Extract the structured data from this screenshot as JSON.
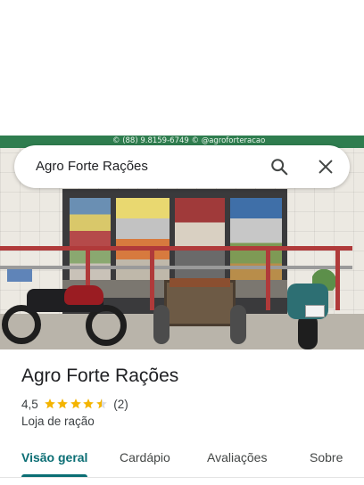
{
  "photo": {
    "banner_text": "© (88) 9.8159-6749 © @agroforteracao"
  },
  "search": {
    "query": "Agro Forte Rações",
    "search_icon": "search-icon",
    "close_icon": "close-icon"
  },
  "place": {
    "name": "Agro Forte Rações",
    "rating": "4,5",
    "stars": 4.5,
    "review_count": "(2)",
    "category": "Loja de ração",
    "star_color": "#f4b400"
  },
  "tabs": [
    {
      "label": "Visão geral",
      "active": true
    },
    {
      "label": "Cardápio",
      "active": false
    },
    {
      "label": "Avaliações",
      "active": false
    },
    {
      "label": "Sobre",
      "active": false
    }
  ],
  "colors": {
    "accent": "#0b6e74"
  }
}
